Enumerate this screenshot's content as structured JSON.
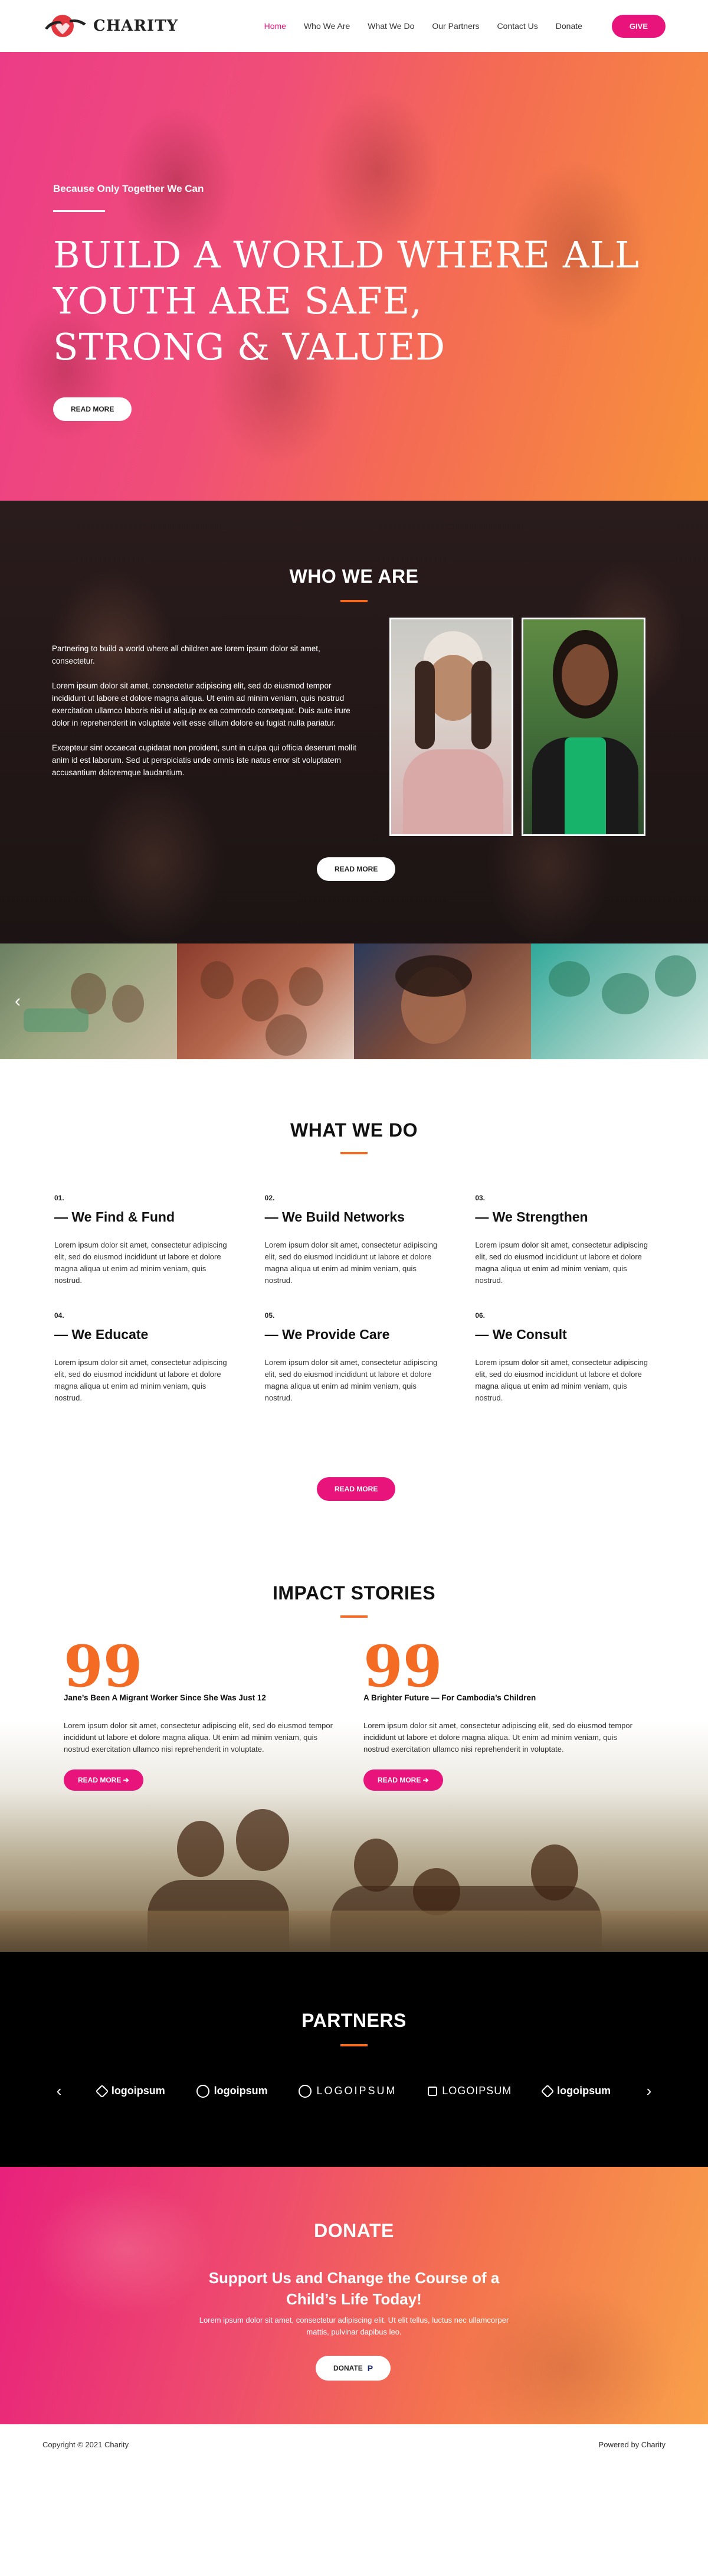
{
  "header": {
    "logo_text": "CHARITY",
    "nav": [
      {
        "label": "Home"
      },
      {
        "label": "Who We Are"
      },
      {
        "label": "What We Do"
      },
      {
        "label": "Our Partners"
      },
      {
        "label": "Contact Us"
      },
      {
        "label": "Donate"
      }
    ],
    "give_label": "GIVE"
  },
  "hero": {
    "subtitle": "Because Only Together We Can",
    "title_line1": "Build a World Where All Youth Are Safe,",
    "title_line2": "Strong & Valued",
    "button_label": "READ MORE"
  },
  "who": {
    "title": "WHO WE ARE",
    "paragraphs": [
      "Partnering to build a world where all children are lorem ipsum dolor sit amet, consectetur.",
      "Lorem ipsum dolor sit amet, consectetur adipiscing elit, sed do eiusmod tempor incididunt ut labore et dolore magna aliqua. Ut enim ad minim veniam, quis nostrud exercitation ullamco laboris nisi ut aliquip ex ea commodo consequat. Duis aute irure dolor in reprehenderit in voluptate velit esse cillum dolore eu fugiat nulla pariatur.",
      "Excepteur sint occaecat cupidatat non proident, sunt in culpa qui officia deserunt mollit anim id est laborum. Sed ut perspiciatis unde omnis iste natus error sit voluptatem accusantium doloremque laudantium."
    ],
    "button_label": "READ MORE"
  },
  "gallery": {
    "prev_arrow": "‹"
  },
  "what": {
    "title": "WHAT WE DO",
    "services": [
      {
        "num": "01.",
        "title": "— We Find & Fund",
        "body": "Lorem ipsum dolor sit amet, consectetur adipiscing elit, sed do eiusmod incididunt ut labore et dolore magna aliqua ut enim ad minim veniam, quis nostrud."
      },
      {
        "num": "02.",
        "title": "— We Build Networks",
        "body": "Lorem ipsum dolor sit amet, consectetur adipiscing elit, sed do eiusmod incididunt ut labore et dolore magna aliqua ut enim ad minim veniam, quis nostrud."
      },
      {
        "num": "03.",
        "title": "— We Strengthen",
        "body": "Lorem ipsum dolor sit amet, consectetur adipiscing elit, sed do eiusmod incididunt ut labore et dolore magna aliqua ut enim ad minim veniam, quis nostrud."
      },
      {
        "num": "04.",
        "title": "— We Educate",
        "body": "Lorem ipsum dolor sit amet, consectetur adipiscing elit, sed do eiusmod incididunt ut labore et dolore magna aliqua ut enim ad minim veniam, quis nostrud."
      },
      {
        "num": "05.",
        "title": "— We Provide Care",
        "body": "Lorem ipsum dolor sit amet, consectetur adipiscing elit, sed do eiusmod incididunt ut labore et dolore magna aliqua ut enim ad minim veniam, quis nostrud."
      },
      {
        "num": "06.",
        "title": "— We Consult",
        "body": "Lorem ipsum dolor sit amet, consectetur adipiscing elit, sed do eiusmod incididunt ut labore et dolore magna aliqua ut enim ad minim veniam, quis nostrud."
      }
    ],
    "button_label": "READ MORE"
  },
  "impact": {
    "title": "IMPACT STORIES",
    "quote_glyph": "99",
    "stories": [
      {
        "title": "Jane’s Been A Migrant Worker Since She Was Just 12",
        "body": "Lorem ipsum dolor sit amet, consectetur adipiscing elit, sed do eiusmod tempor incididunt ut labore et dolore magna aliqua. Ut enim ad minim veniam, quis nostrud exercitation ullamco nisi reprehenderit in voluptate.",
        "button_label": "READ MORE ➔"
      },
      {
        "title": "A Brighter Future — For Cambodia’s Children",
        "body": "Lorem ipsum dolor sit amet, consectetur adipiscing elit, sed do eiusmod tempor incididunt ut labore et dolore magna aliqua. Ut enim ad minim veniam, quis nostrud exercitation ullamco nisi reprehenderit in voluptate.",
        "button_label": "READ MORE ➔"
      }
    ]
  },
  "partners": {
    "title": "PARTNERS",
    "prev_arrow": "‹",
    "next_arrow": "›",
    "logos": [
      {
        "text": "logoipsum",
        "icon": "grid-mark-icon"
      },
      {
        "text": "logoipsum",
        "icon": "circle-mark-icon"
      },
      {
        "text": "LOGOIPSUM",
        "icon": "ring-mark-icon"
      },
      {
        "text": "LOGOIPSUM",
        "icon": "tile-mark-icon"
      },
      {
        "text": "logoipsum",
        "icon": "grid-mark-icon"
      }
    ]
  },
  "donate": {
    "title": "DONATE",
    "subtitle": "Support Us and Change the Course of a Child’s Life Today!",
    "body": "Lorem ipsum dolor sit amet, consectetur adipiscing elit. Ut elit tellus, luctus nec ullamcorper mattis, pulvinar dapibus leo.",
    "button_label": "DONATE",
    "button_icon": "P"
  },
  "footer": {
    "copyright": "Copyright © 2021 Charity",
    "powered": "Powered by Charity"
  },
  "colors": {
    "accent_pink": "#e8137b",
    "accent_orange": "#f46b24"
  }
}
